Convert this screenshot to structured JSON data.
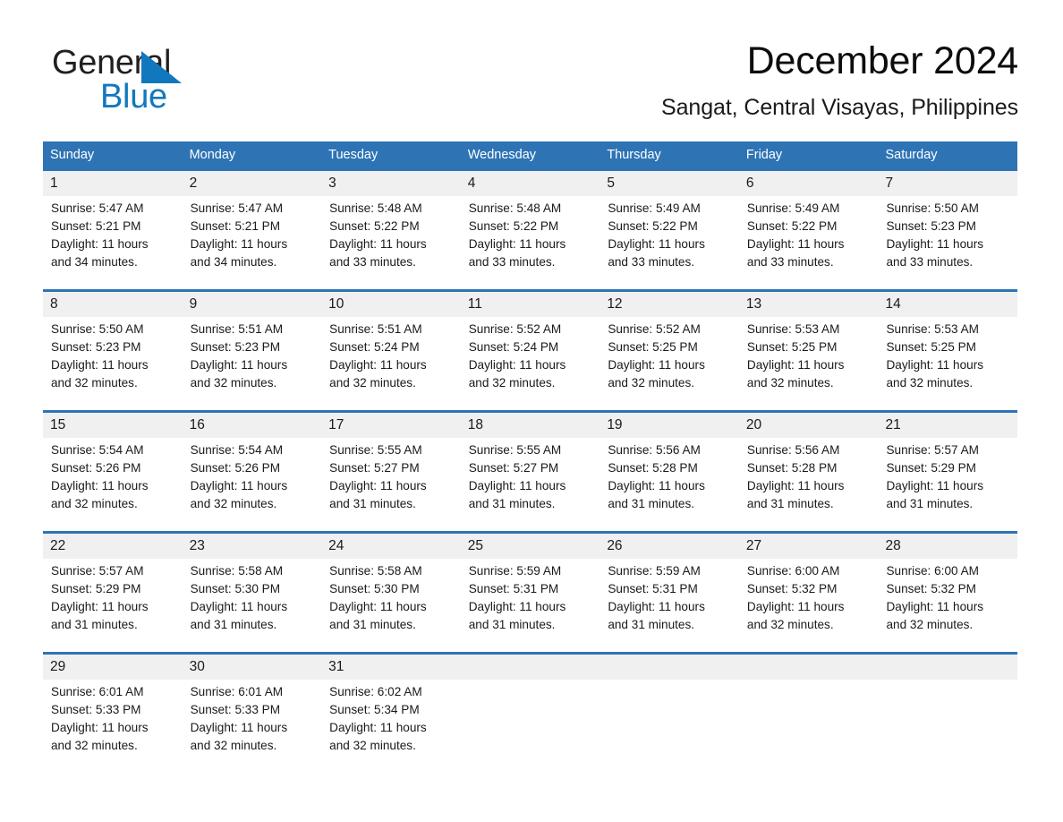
{
  "brand": {
    "word1": "General",
    "word2": "Blue",
    "triangle_color": "#1278be",
    "text_color": "#231f20"
  },
  "header": {
    "title": "December 2024",
    "subtitle": "Sangat, Central Visayas, Philippines"
  },
  "theme": {
    "header_blue": "#2e74b5",
    "daynum_strip": "#f0f0f0",
    "divider_blue": "#2e74b5"
  },
  "weekdays": [
    "Sunday",
    "Monday",
    "Tuesday",
    "Wednesday",
    "Thursday",
    "Friday",
    "Saturday"
  ],
  "weeks": [
    [
      {
        "day": "1",
        "sunrise": "Sunrise: 5:47 AM",
        "sunset": "Sunset: 5:21 PM",
        "daylight1": "Daylight: 11 hours",
        "daylight2": "and 34 minutes."
      },
      {
        "day": "2",
        "sunrise": "Sunrise: 5:47 AM",
        "sunset": "Sunset: 5:21 PM",
        "daylight1": "Daylight: 11 hours",
        "daylight2": "and 34 minutes."
      },
      {
        "day": "3",
        "sunrise": "Sunrise: 5:48 AM",
        "sunset": "Sunset: 5:22 PM",
        "daylight1": "Daylight: 11 hours",
        "daylight2": "and 33 minutes."
      },
      {
        "day": "4",
        "sunrise": "Sunrise: 5:48 AM",
        "sunset": "Sunset: 5:22 PM",
        "daylight1": "Daylight: 11 hours",
        "daylight2": "and 33 minutes."
      },
      {
        "day": "5",
        "sunrise": "Sunrise: 5:49 AM",
        "sunset": "Sunset: 5:22 PM",
        "daylight1": "Daylight: 11 hours",
        "daylight2": "and 33 minutes."
      },
      {
        "day": "6",
        "sunrise": "Sunrise: 5:49 AM",
        "sunset": "Sunset: 5:22 PM",
        "daylight1": "Daylight: 11 hours",
        "daylight2": "and 33 minutes."
      },
      {
        "day": "7",
        "sunrise": "Sunrise: 5:50 AM",
        "sunset": "Sunset: 5:23 PM",
        "daylight1": "Daylight: 11 hours",
        "daylight2": "and 33 minutes."
      }
    ],
    [
      {
        "day": "8",
        "sunrise": "Sunrise: 5:50 AM",
        "sunset": "Sunset: 5:23 PM",
        "daylight1": "Daylight: 11 hours",
        "daylight2": "and 32 minutes."
      },
      {
        "day": "9",
        "sunrise": "Sunrise: 5:51 AM",
        "sunset": "Sunset: 5:23 PM",
        "daylight1": "Daylight: 11 hours",
        "daylight2": "and 32 minutes."
      },
      {
        "day": "10",
        "sunrise": "Sunrise: 5:51 AM",
        "sunset": "Sunset: 5:24 PM",
        "daylight1": "Daylight: 11 hours",
        "daylight2": "and 32 minutes."
      },
      {
        "day": "11",
        "sunrise": "Sunrise: 5:52 AM",
        "sunset": "Sunset: 5:24 PM",
        "daylight1": "Daylight: 11 hours",
        "daylight2": "and 32 minutes."
      },
      {
        "day": "12",
        "sunrise": "Sunrise: 5:52 AM",
        "sunset": "Sunset: 5:25 PM",
        "daylight1": "Daylight: 11 hours",
        "daylight2": "and 32 minutes."
      },
      {
        "day": "13",
        "sunrise": "Sunrise: 5:53 AM",
        "sunset": "Sunset: 5:25 PM",
        "daylight1": "Daylight: 11 hours",
        "daylight2": "and 32 minutes."
      },
      {
        "day": "14",
        "sunrise": "Sunrise: 5:53 AM",
        "sunset": "Sunset: 5:25 PM",
        "daylight1": "Daylight: 11 hours",
        "daylight2": "and 32 minutes."
      }
    ],
    [
      {
        "day": "15",
        "sunrise": "Sunrise: 5:54 AM",
        "sunset": "Sunset: 5:26 PM",
        "daylight1": "Daylight: 11 hours",
        "daylight2": "and 32 minutes."
      },
      {
        "day": "16",
        "sunrise": "Sunrise: 5:54 AM",
        "sunset": "Sunset: 5:26 PM",
        "daylight1": "Daylight: 11 hours",
        "daylight2": "and 32 minutes."
      },
      {
        "day": "17",
        "sunrise": "Sunrise: 5:55 AM",
        "sunset": "Sunset: 5:27 PM",
        "daylight1": "Daylight: 11 hours",
        "daylight2": "and 31 minutes."
      },
      {
        "day": "18",
        "sunrise": "Sunrise: 5:55 AM",
        "sunset": "Sunset: 5:27 PM",
        "daylight1": "Daylight: 11 hours",
        "daylight2": "and 31 minutes."
      },
      {
        "day": "19",
        "sunrise": "Sunrise: 5:56 AM",
        "sunset": "Sunset: 5:28 PM",
        "daylight1": "Daylight: 11 hours",
        "daylight2": "and 31 minutes."
      },
      {
        "day": "20",
        "sunrise": "Sunrise: 5:56 AM",
        "sunset": "Sunset: 5:28 PM",
        "daylight1": "Daylight: 11 hours",
        "daylight2": "and 31 minutes."
      },
      {
        "day": "21",
        "sunrise": "Sunrise: 5:57 AM",
        "sunset": "Sunset: 5:29 PM",
        "daylight1": "Daylight: 11 hours",
        "daylight2": "and 31 minutes."
      }
    ],
    [
      {
        "day": "22",
        "sunrise": "Sunrise: 5:57 AM",
        "sunset": "Sunset: 5:29 PM",
        "daylight1": "Daylight: 11 hours",
        "daylight2": "and 31 minutes."
      },
      {
        "day": "23",
        "sunrise": "Sunrise: 5:58 AM",
        "sunset": "Sunset: 5:30 PM",
        "daylight1": "Daylight: 11 hours",
        "daylight2": "and 31 minutes."
      },
      {
        "day": "24",
        "sunrise": "Sunrise: 5:58 AM",
        "sunset": "Sunset: 5:30 PM",
        "daylight1": "Daylight: 11 hours",
        "daylight2": "and 31 minutes."
      },
      {
        "day": "25",
        "sunrise": "Sunrise: 5:59 AM",
        "sunset": "Sunset: 5:31 PM",
        "daylight1": "Daylight: 11 hours",
        "daylight2": "and 31 minutes."
      },
      {
        "day": "26",
        "sunrise": "Sunrise: 5:59 AM",
        "sunset": "Sunset: 5:31 PM",
        "daylight1": "Daylight: 11 hours",
        "daylight2": "and 31 minutes."
      },
      {
        "day": "27",
        "sunrise": "Sunrise: 6:00 AM",
        "sunset": "Sunset: 5:32 PM",
        "daylight1": "Daylight: 11 hours",
        "daylight2": "and 32 minutes."
      },
      {
        "day": "28",
        "sunrise": "Sunrise: 6:00 AM",
        "sunset": "Sunset: 5:32 PM",
        "daylight1": "Daylight: 11 hours",
        "daylight2": "and 32 minutes."
      }
    ],
    [
      {
        "day": "29",
        "sunrise": "Sunrise: 6:01 AM",
        "sunset": "Sunset: 5:33 PM",
        "daylight1": "Daylight: 11 hours",
        "daylight2": "and 32 minutes."
      },
      {
        "day": "30",
        "sunrise": "Sunrise: 6:01 AM",
        "sunset": "Sunset: 5:33 PM",
        "daylight1": "Daylight: 11 hours",
        "daylight2": "and 32 minutes."
      },
      {
        "day": "31",
        "sunrise": "Sunrise: 6:02 AM",
        "sunset": "Sunset: 5:34 PM",
        "daylight1": "Daylight: 11 hours",
        "daylight2": "and 32 minutes."
      },
      {
        "day": "",
        "sunrise": "",
        "sunset": "",
        "daylight1": "",
        "daylight2": ""
      },
      {
        "day": "",
        "sunrise": "",
        "sunset": "",
        "daylight1": "",
        "daylight2": ""
      },
      {
        "day": "",
        "sunrise": "",
        "sunset": "",
        "daylight1": "",
        "daylight2": ""
      },
      {
        "day": "",
        "sunrise": "",
        "sunset": "",
        "daylight1": "",
        "daylight2": ""
      }
    ]
  ]
}
